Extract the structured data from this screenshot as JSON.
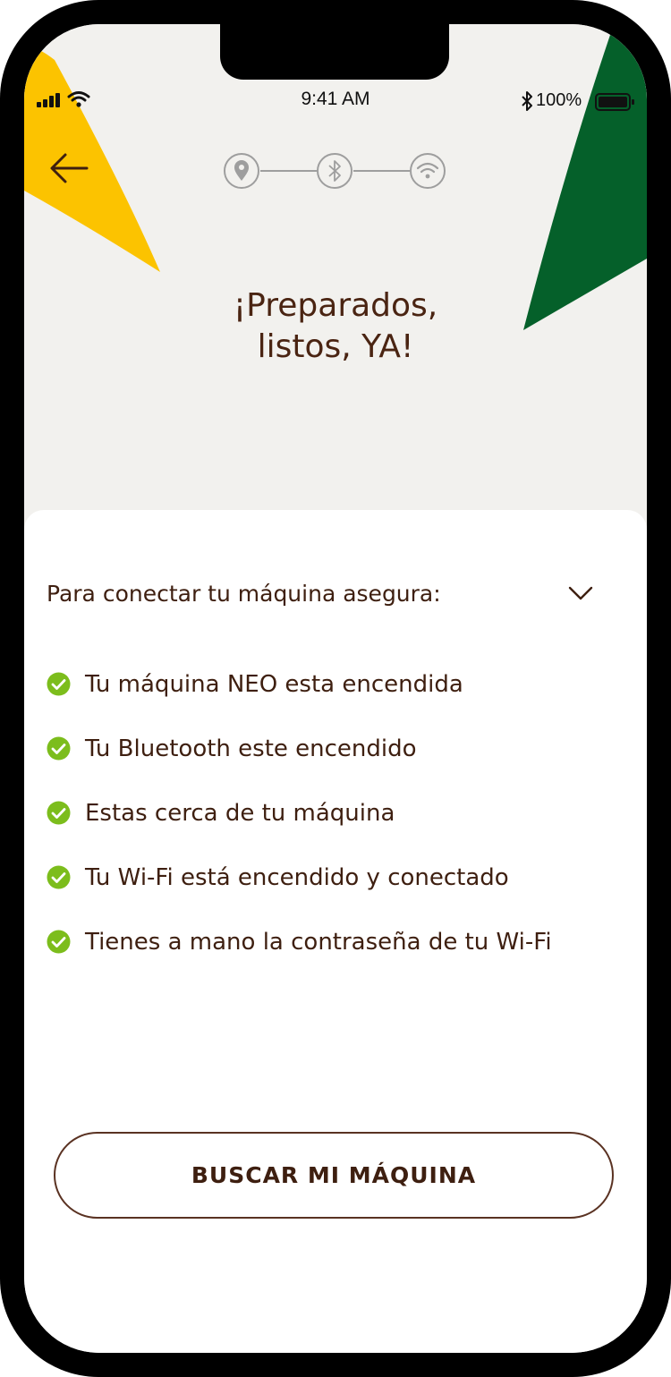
{
  "status_bar": {
    "time": "9:41 AM",
    "battery": "100%",
    "icons": [
      "cellular-signal-icon",
      "wifi-icon",
      "bluetooth-icon",
      "battery-icon"
    ]
  },
  "navigation": {
    "back_icon": "arrow-left-icon"
  },
  "stepper": {
    "steps": [
      {
        "icon": "location-pin-icon"
      },
      {
        "icon": "bluetooth-icon"
      },
      {
        "icon": "wifi-icon"
      }
    ]
  },
  "hero": {
    "title_line1": "¡Preparados,",
    "title_line2": "listos, YA!"
  },
  "checklist": {
    "title": "Para conectar tu máquina asegura:",
    "toggle_icon": "chevron-down-icon",
    "items": [
      {
        "label": "Tu máquina NEO esta encendida"
      },
      {
        "label": "Tu Bluetooth este encendido"
      },
      {
        "label": "Estas cerca de tu máquina"
      },
      {
        "label": "Tu Wi-Fi está encendido y conectado"
      },
      {
        "label": "Tienes a mano la contraseña de tu Wi-Fi"
      }
    ]
  },
  "action": {
    "button_label": "BUSCAR MI MÁQUINA"
  },
  "colors": {
    "brand_brown": "#3e1f10",
    "accent_yellow": "#fcc300",
    "accent_green": "#05602a",
    "check_green": "#7cbd1c",
    "background": "#f2f1ee"
  }
}
